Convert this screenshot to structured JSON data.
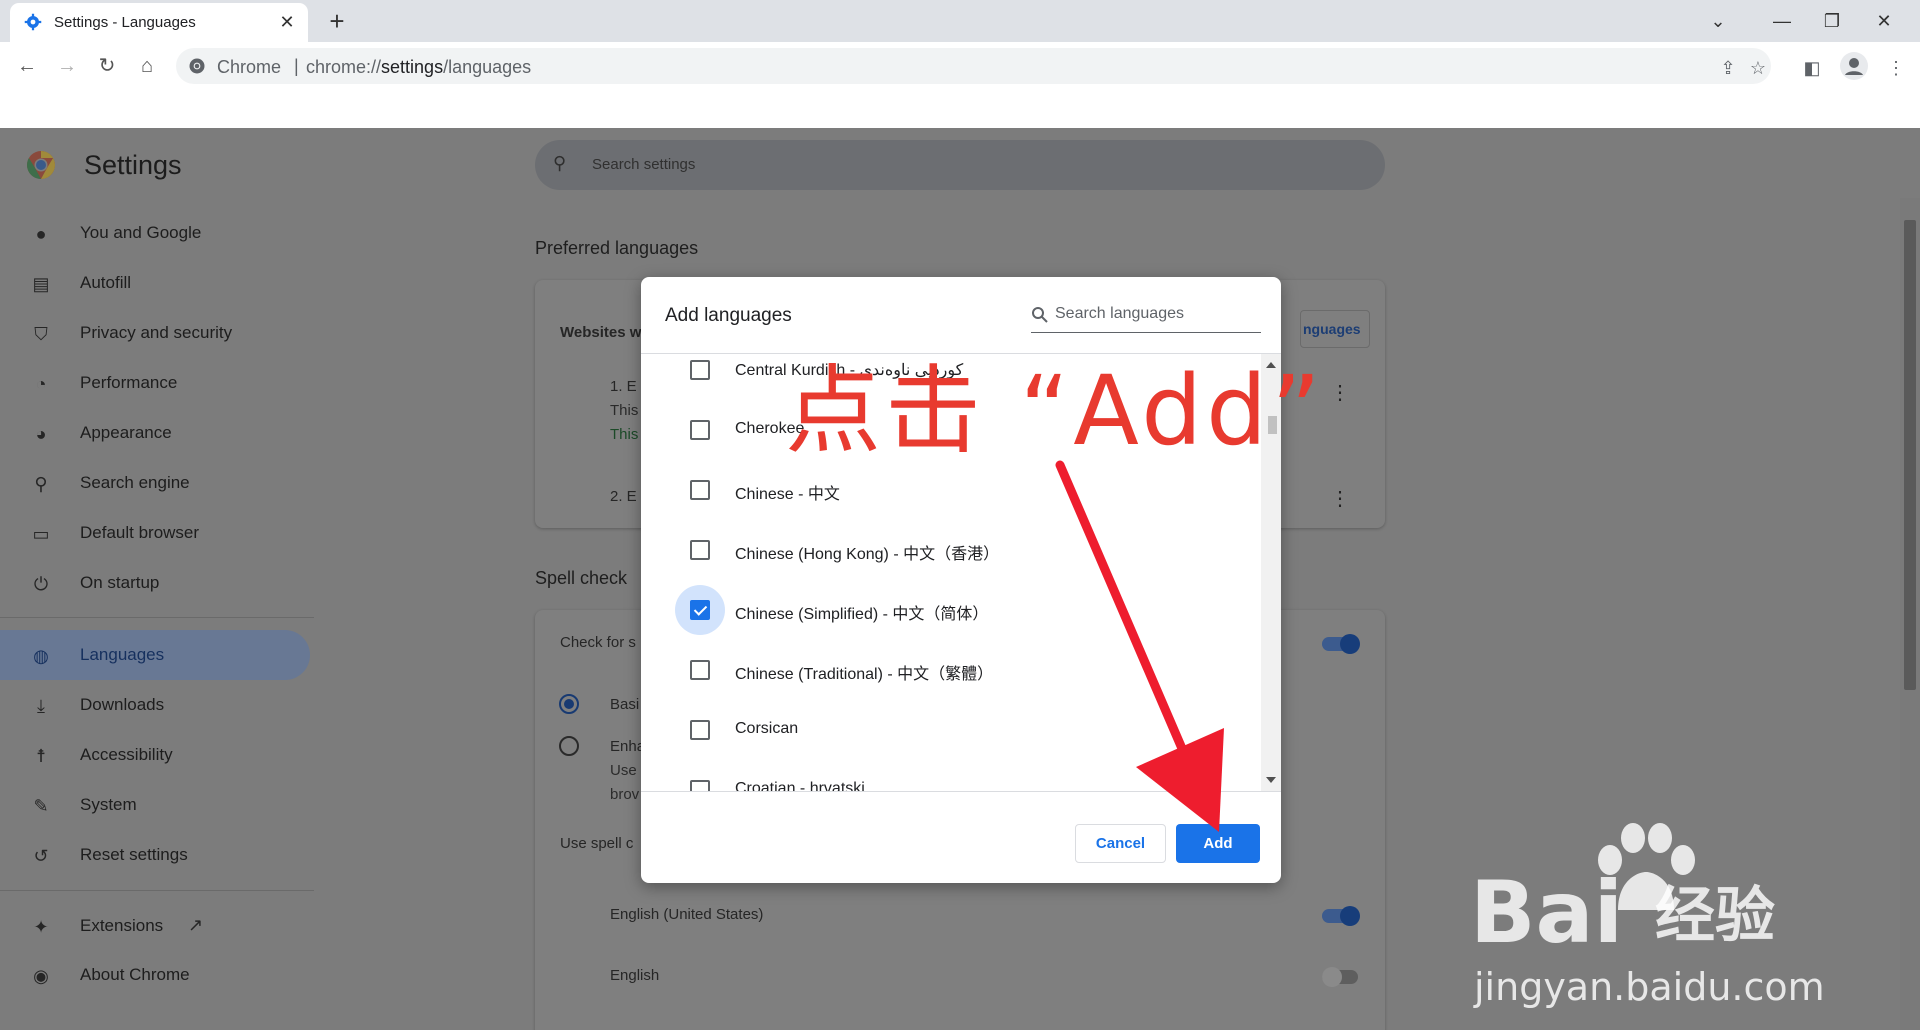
{
  "tab": {
    "title": "Settings - Languages",
    "close": "✕",
    "new_tab": "+"
  },
  "window_controls": {
    "dropdown": "⌄",
    "minimize": "—",
    "restore": "❐",
    "close": "✕"
  },
  "toolbar": {
    "site_label": "Chrome",
    "separator": "|",
    "url_host": "chrome://",
    "url_path_bold": "settings",
    "url_path_rest": "/languages"
  },
  "settings": {
    "title": "Settings",
    "search_placeholder": "Search settings",
    "nav": [
      {
        "label": "You and Google",
        "icon": "person-icon"
      },
      {
        "label": "Autofill",
        "icon": "clipboard-icon"
      },
      {
        "label": "Privacy and security",
        "icon": "shield-icon"
      },
      {
        "label": "Performance",
        "icon": "speedometer-icon"
      },
      {
        "label": "Appearance",
        "icon": "palette-icon"
      },
      {
        "label": "Search engine",
        "icon": "search-icon"
      },
      {
        "label": "Default browser",
        "icon": "browser-icon"
      },
      {
        "label": "On startup",
        "icon": "power-icon"
      },
      {
        "label": "Languages",
        "icon": "globe-icon",
        "active": true
      },
      {
        "label": "Downloads",
        "icon": "download-icon"
      },
      {
        "label": "Accessibility",
        "icon": "accessibility-icon"
      },
      {
        "label": "System",
        "icon": "wrench-icon"
      },
      {
        "label": "Reset settings",
        "icon": "history-icon"
      },
      {
        "label": "Extensions",
        "icon": "puzzle-icon"
      },
      {
        "label": "About Chrome",
        "icon": "chrome-icon"
      }
    ],
    "preferred_languages_title": "Preferred languages",
    "websites_partial": "Websites w",
    "languages_button_partial": "nguages",
    "lang1_partial": "1. E",
    "lang1_line2_partial": "This",
    "lang1_line3_partial": "This",
    "lang2_partial": "2. E",
    "spell_check_title": "Spell check",
    "check_for_partial": "Check for s",
    "basic_partial": "Basi",
    "enhanced_partial": "Enha",
    "enhanced_line2_partial": "Use",
    "enhanced_line3_partial": "brov",
    "use_spell_partial": "Use spell c",
    "spell_lang_1": "English (United States)",
    "spell_lang_2": "English"
  },
  "dialog": {
    "title": "Add languages",
    "search_placeholder": "Search languages",
    "languages": [
      {
        "name": "Central Kurdish - کوردیی ناوەندی",
        "checked": false
      },
      {
        "name": "Cherokee",
        "checked": false
      },
      {
        "name": "Chinese - 中文",
        "checked": false
      },
      {
        "name": "Chinese (Hong Kong) - 中文（香港）",
        "checked": false
      },
      {
        "name": "Chinese (Simplified) - 中文（简体）",
        "checked": true
      },
      {
        "name": "Chinese (Traditional) - 中文（繁體）",
        "checked": false
      },
      {
        "name": "Corsican",
        "checked": false
      },
      {
        "name": "Croatian - hrvatski",
        "checked": false
      }
    ],
    "cancel_label": "Cancel",
    "add_label": "Add"
  },
  "annotation": {
    "text": "点击 “Add”",
    "color": "#e83a2f"
  },
  "watermark": {
    "brand": "Bai",
    "suffix": "经验",
    "url": "jingyan.baidu.com"
  },
  "colors": {
    "accent": "#1a73e8",
    "toggle_on": "#174ea6",
    "annotation": "#e83a2f"
  }
}
